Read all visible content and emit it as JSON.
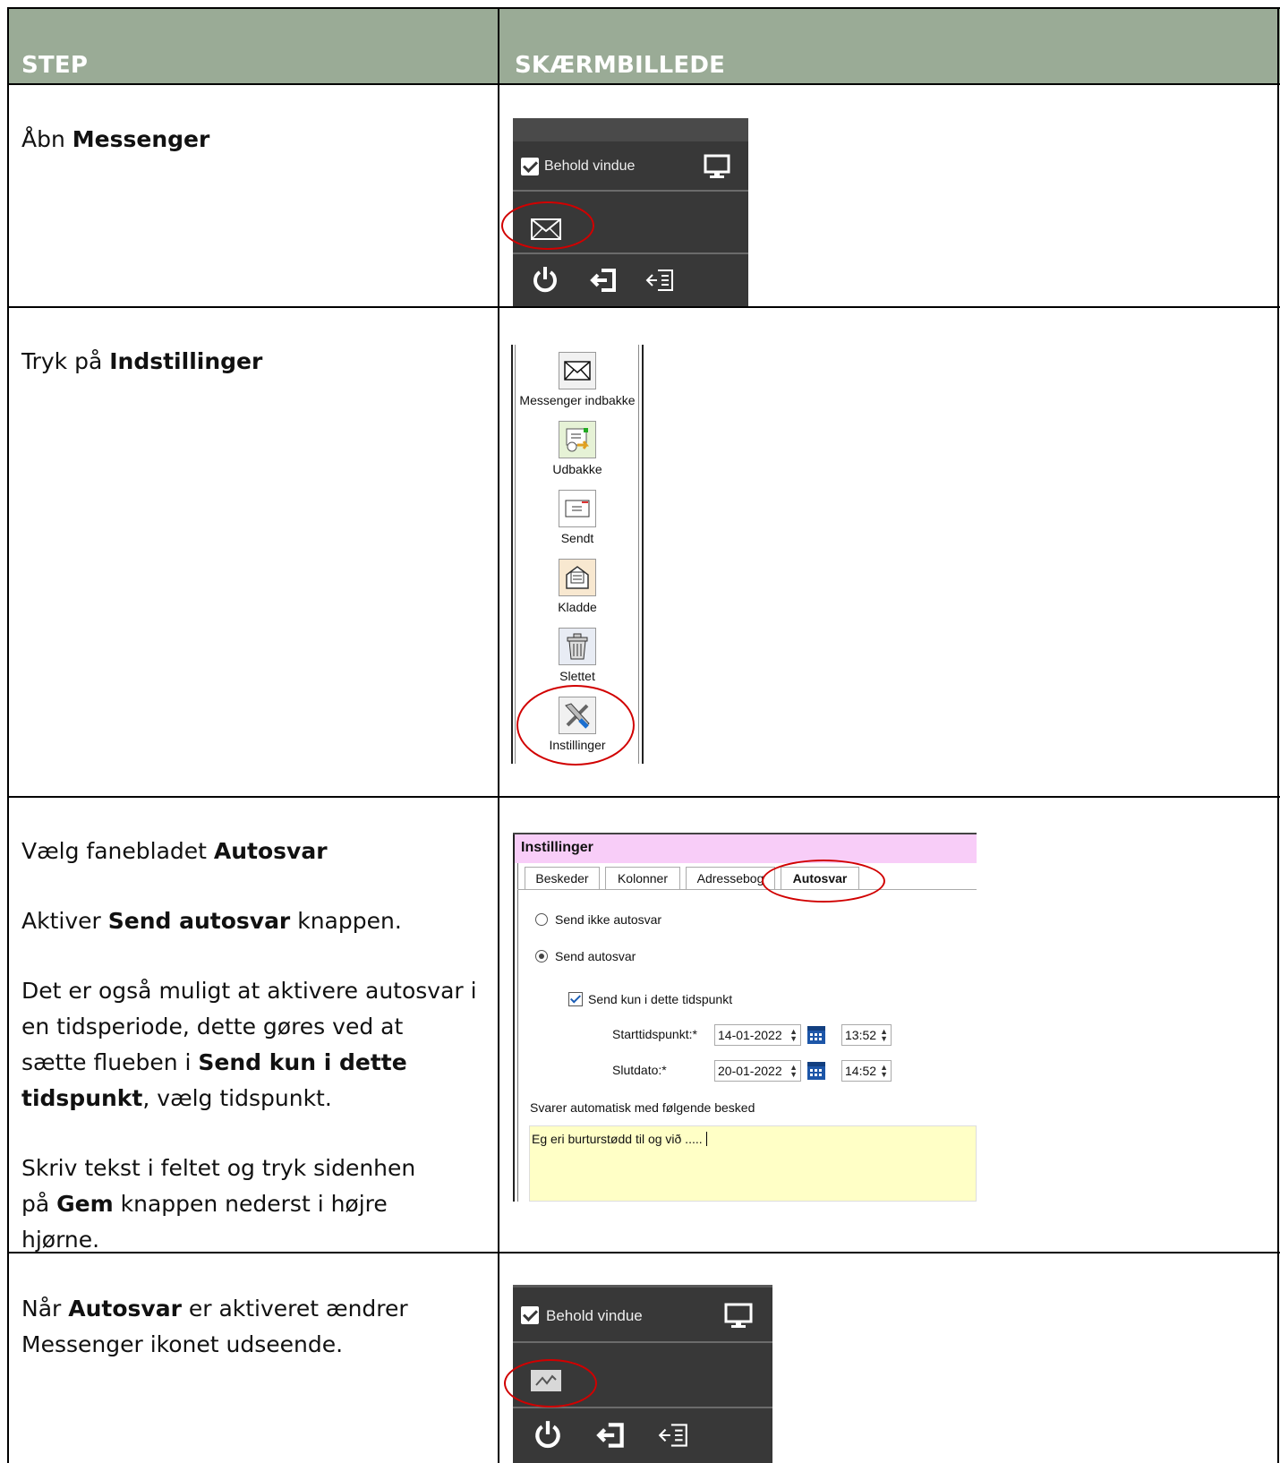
{
  "header": {
    "step_label": "STEP",
    "screenshot_label": "SKÆRMBILLEDE"
  },
  "rows": {
    "r1": {
      "pre": "Åbn ",
      "bold": "Messenger"
    },
    "r2": {
      "pre": "Tryk på ",
      "bold": "Indstillinger"
    },
    "r3": {
      "p1_pre": "Vælg fanebladet ",
      "p1_bold": "Autosvar",
      "p2_pre": "Aktiver ",
      "p2_bold": "Send autosvar",
      "p2_post": " knappen.",
      "p3_line1": "Det er også muligt at aktivere autosvar i",
      "p3_line2": "en tidsperiode, dette gøres ved at",
      "p3_line3_pre": "sætte flueben i ",
      "p3_line3_bold": "Send kun i dette",
      "p3_line4_bold": "tidspunkt",
      "p3_line4_post": ", vælg tidspunkt.",
      "p4_line1": "Skriv tekst i feltet og tryk sidenhen",
      "p4_line2_pre": "på ",
      "p4_line2_bold": "Gem",
      "p4_line2_post": " knappen nederst i højre",
      "p4_line3": "hjørne."
    },
    "r4": {
      "l1_pre": "Når ",
      "l1_bold": "Autosvar",
      "l1_post": " er aktiveret ændrer",
      "l2": "Messenger ikonet udseende."
    }
  },
  "messenger_panel": {
    "keep_window": "Behold vindue"
  },
  "sidebar": {
    "items": [
      "Messenger indbakke",
      "Udbakke",
      "Sendt",
      "Kladde",
      "Slettet",
      "Instillinger"
    ]
  },
  "settings": {
    "title": "Instillinger",
    "tabs": [
      "Beskeder",
      "Kolonner",
      "Adressebog",
      "Autosvar"
    ],
    "radio_off": "Send ikke autosvar",
    "radio_on": "Send autosvar",
    "checkbox": "Send kun i dette tidspunkt",
    "start_label": "Starttidspunkt:*",
    "start_date": "14-01-2022",
    "start_time": "13:52",
    "end_label": "Slutdato:*",
    "end_date": "20-01-2022",
    "end_time": "14:52",
    "reply_label": "Svarer automatisk med følgende besked",
    "reply_text": "Eg eri burturstødd til og við ....."
  },
  "colors": {
    "header_bg": "#9aab96",
    "panel_bg": "#383838",
    "settings_title_bg": "#f8cdf8",
    "textarea_bg": "#ffffc6",
    "highlight": "#d10000"
  }
}
